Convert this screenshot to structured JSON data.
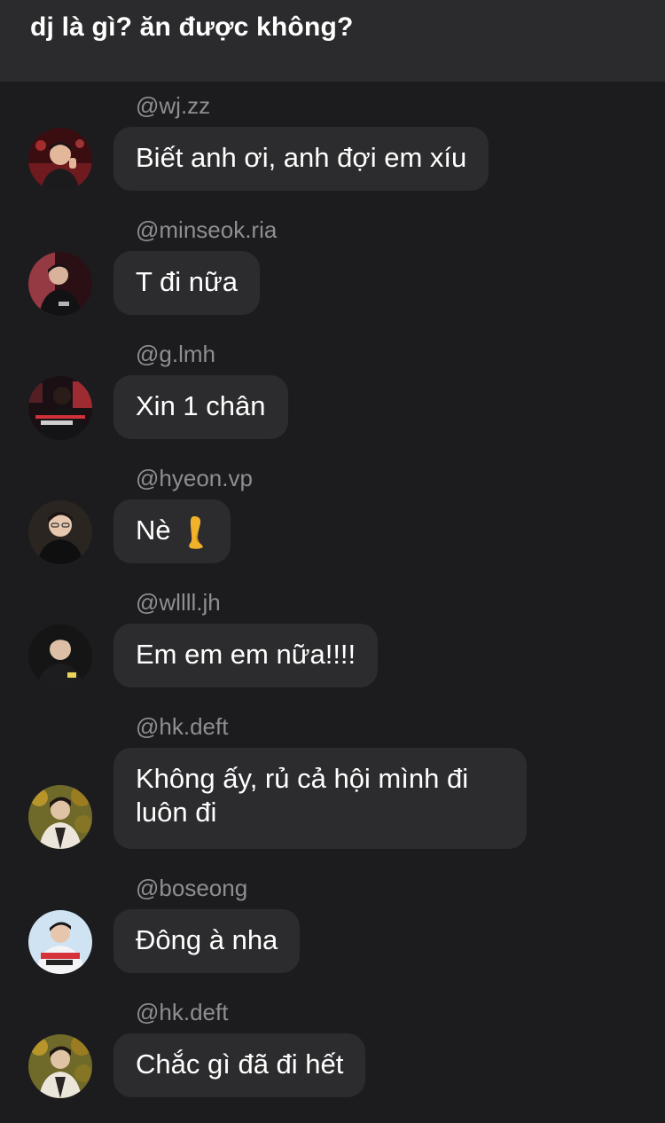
{
  "header": {
    "title": "dj là gì? ăn được không?"
  },
  "messages": [
    {
      "handle": "@wj.zz",
      "text": "Biết anh ơi, anh đợi em xíu",
      "avatar": "avatar-wj-zz"
    },
    {
      "handle": "@minseok.ria",
      "text": "T đi nữa",
      "avatar": "avatar-minseok-ria"
    },
    {
      "handle": "@g.lmh",
      "text": "Xin 1 chân",
      "avatar": "avatar-g-lmh"
    },
    {
      "handle": "@hyeon.vp",
      "text": "Nè",
      "emoji": "leg-icon",
      "avatar": "avatar-hyeon-vp"
    },
    {
      "handle": "@wllll.jh",
      "text": "Em em em nữa!!!!",
      "avatar": "avatar-wllll-jh"
    },
    {
      "handle": "@hk.deft",
      "text_line1": "Không ấy, rủ cả hội mình đi",
      "text_line2": "luôn đi",
      "avatar": "avatar-hk-deft"
    },
    {
      "handle": "@boseong",
      "text": "Đông à nha",
      "avatar": "avatar-boseong"
    },
    {
      "handle": "@hk.deft",
      "text": "Chắc gì đã đi hết",
      "avatar": "avatar-hk-deft"
    }
  ],
  "colors": {
    "background": "#1c1c1e",
    "header": "#2b2b2d",
    "bubble": "#2c2c2e",
    "handle": "#8e8e93",
    "text": "#ffffff"
  }
}
